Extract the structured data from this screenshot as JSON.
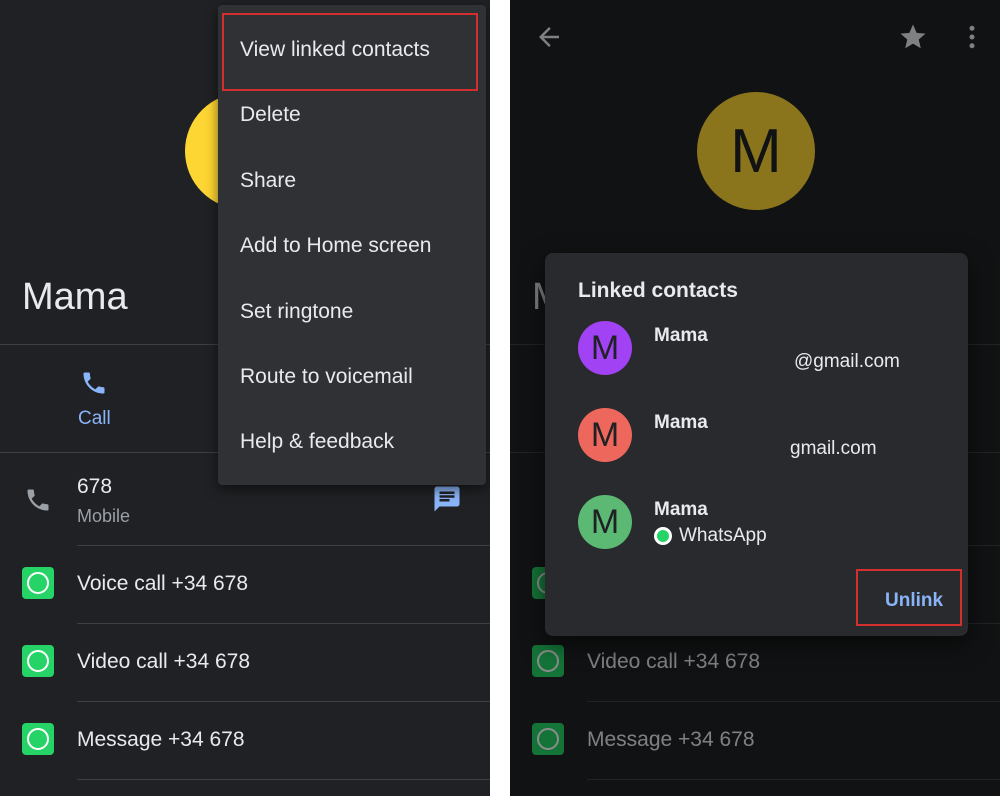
{
  "left": {
    "contact_name": "Mama",
    "actions": {
      "call_label": "Call"
    },
    "phone": {
      "number": "678",
      "type": "Mobile"
    },
    "whatsapp_rows": [
      {
        "label": "Voice call +34 678"
      },
      {
        "label": "Video call +34 678"
      },
      {
        "label": "Message +34 678"
      }
    ],
    "menu": {
      "items": [
        {
          "label": "View linked contacts"
        },
        {
          "label": "Delete"
        },
        {
          "label": "Share"
        },
        {
          "label": "Add to Home screen"
        },
        {
          "label": "Set ringtone"
        },
        {
          "label": "Route to voicemail"
        },
        {
          "label": "Help & feedback"
        }
      ]
    }
  },
  "right": {
    "avatar_letter": "M",
    "contact_name_partial": "M",
    "rows": [
      {
        "label": "Video call +34 678"
      },
      {
        "label": "Message +34 678"
      }
    ],
    "dialog": {
      "title": "Linked contacts",
      "contacts": [
        {
          "letter": "M",
          "name": "Mama",
          "sub": "@gmail.com",
          "color": "#a142f4"
        },
        {
          "letter": "M",
          "name": "Mama",
          "sub": "gmail.com",
          "color": "#ee675c"
        },
        {
          "letter": "M",
          "name": "Mama",
          "sub": "WhatsApp",
          "color": "#5bb974"
        }
      ],
      "unlink_label": "Unlink"
    }
  },
  "colors": {
    "background": "#202124",
    "accent_blue": "#8ab4f8",
    "avatar_yellow": "#fdd633",
    "highlight_red": "#d32f2f",
    "whatsapp_green": "#25d366"
  },
  "icons": [
    "phone-icon",
    "message-icon",
    "whatsapp-icon",
    "back-arrow-icon",
    "star-icon",
    "more-vert-icon"
  ]
}
